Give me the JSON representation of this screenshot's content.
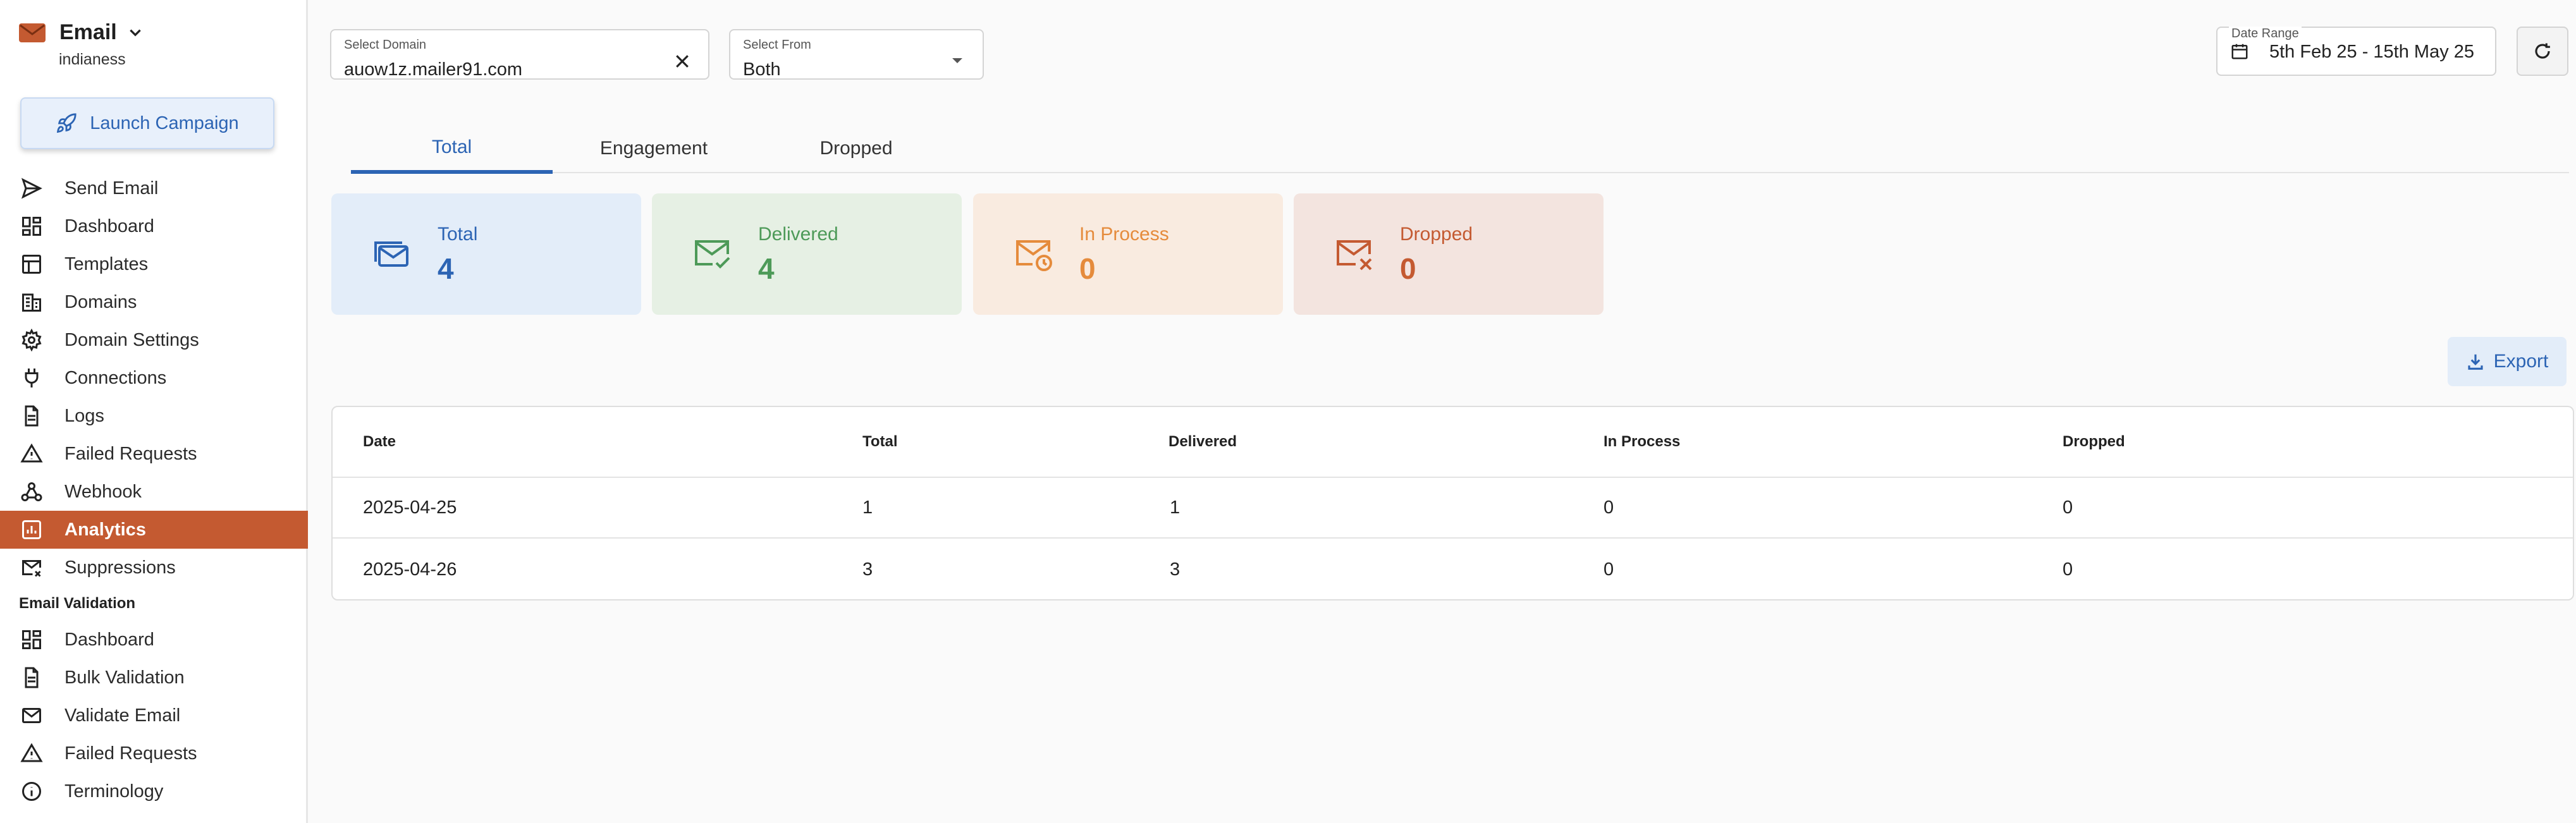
{
  "sidebar": {
    "brand_title": "Email",
    "brand_subtitle": "indianess",
    "launch_label": "Launch Campaign",
    "items": [
      {
        "label": "Send Email",
        "icon": "send-icon"
      },
      {
        "label": "Dashboard",
        "icon": "dashboard-icon"
      },
      {
        "label": "Templates",
        "icon": "templates-icon"
      },
      {
        "label": "Domains",
        "icon": "domains-icon"
      },
      {
        "label": "Domain Settings",
        "icon": "gear-icon"
      },
      {
        "label": "Connections",
        "icon": "plug-icon"
      },
      {
        "label": "Logs",
        "icon": "logs-icon"
      },
      {
        "label": "Failed Requests",
        "icon": "warning-icon"
      },
      {
        "label": "Webhook",
        "icon": "webhook-icon"
      },
      {
        "label": "Analytics",
        "icon": "analytics-icon",
        "active": true
      },
      {
        "label": "Suppressions",
        "icon": "suppressions-icon"
      }
    ],
    "section_title": "Email Validation",
    "validation_items": [
      {
        "label": "Dashboard",
        "icon": "dashboard-icon"
      },
      {
        "label": "Bulk Validation",
        "icon": "document-icon"
      },
      {
        "label": "Validate Email",
        "icon": "mail-icon"
      },
      {
        "label": "Failed Requests",
        "icon": "warning-icon"
      },
      {
        "label": "Terminology",
        "icon": "info-icon"
      }
    ]
  },
  "filters": {
    "domain_label": "Select Domain",
    "domain_value": "auow1z.mailer91.com",
    "from_label": "Select From",
    "from_value": "Both",
    "date_label": "Date Range",
    "date_value": "5th Feb 25 - 15th May 25"
  },
  "tabs": [
    "Total",
    "Engagement",
    "Dropped"
  ],
  "active_tab": "Total",
  "stats": [
    {
      "label": "Total",
      "value": "4",
      "color": "#2c64b4",
      "bg": "#e3edf9"
    },
    {
      "label": "Delivered",
      "value": "4",
      "color": "#4d9a58",
      "bg": "#e6f0e4"
    },
    {
      "label": "In Process",
      "value": "0",
      "color": "#e58b3c",
      "bg": "#f9ebe0"
    },
    {
      "label": "Dropped",
      "value": "0",
      "color": "#c45a31",
      "bg": "#f3e4df"
    }
  ],
  "export_label": "Export",
  "table": {
    "headers": [
      "Date",
      "Total",
      "Delivered",
      "In Process",
      "Dropped"
    ],
    "rows": [
      [
        "2025-04-25",
        "1",
        "1",
        "0",
        "0"
      ],
      [
        "2025-04-26",
        "3",
        "3",
        "0",
        "0"
      ]
    ]
  },
  "colors": {
    "accent": "#c45a31",
    "primary": "#2c64b4"
  }
}
